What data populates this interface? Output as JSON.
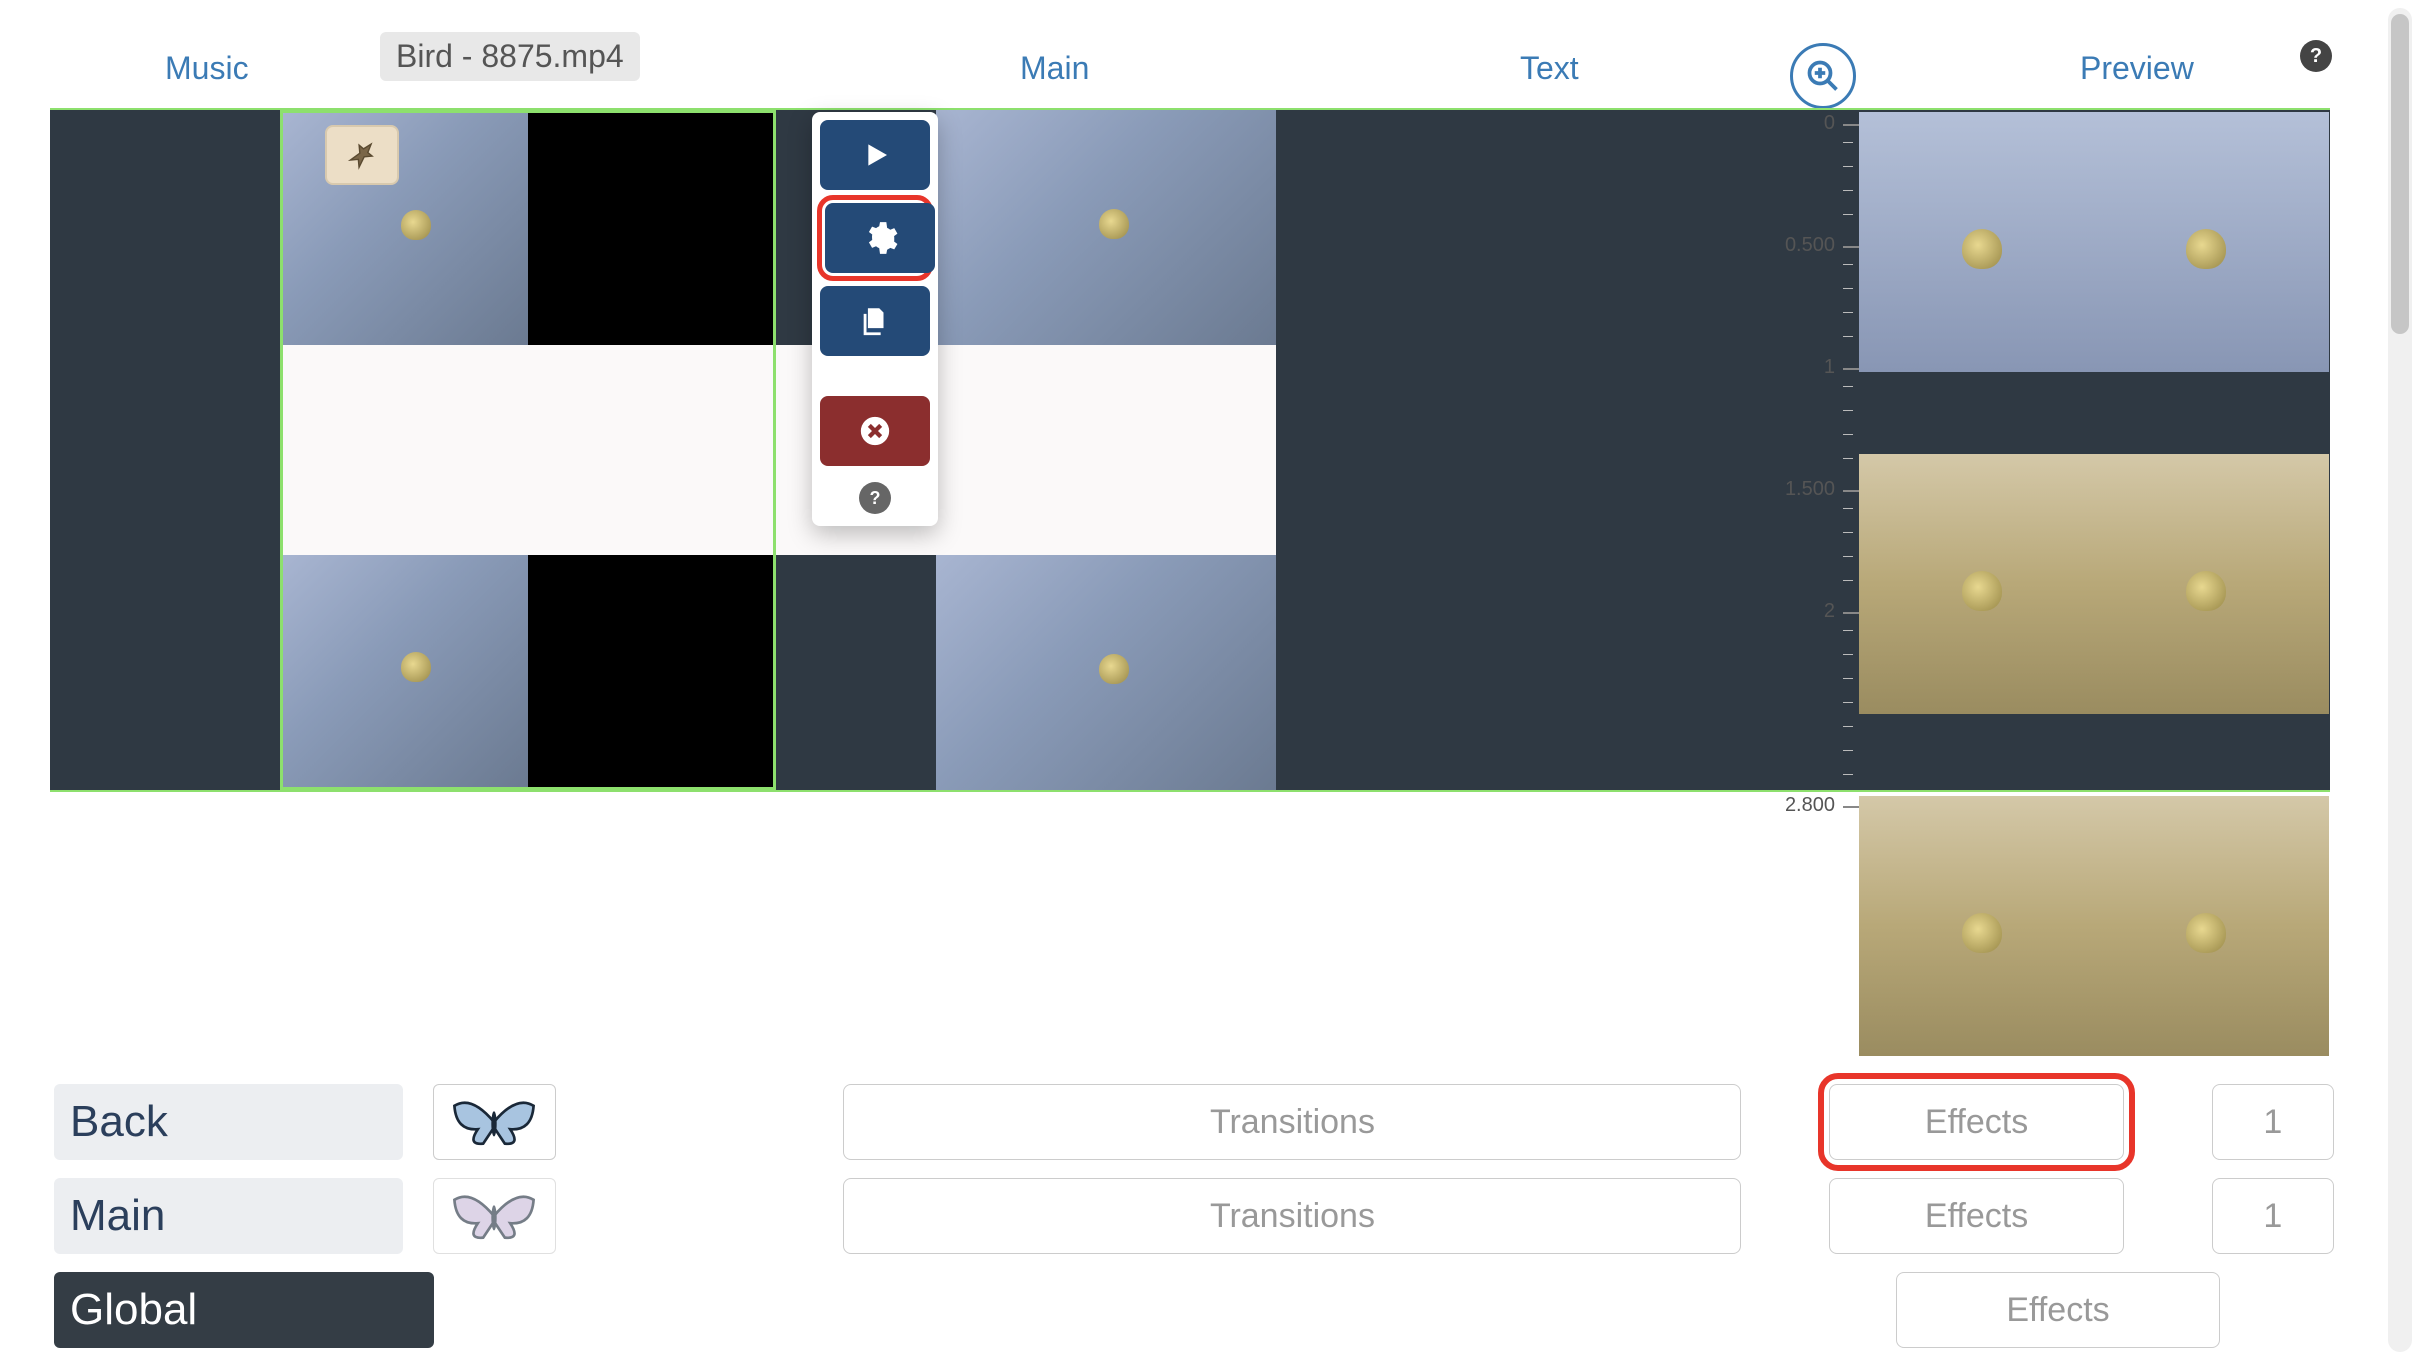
{
  "tabs": {
    "music": "Music",
    "main": "Main",
    "text": "Text",
    "preview": "Preview"
  },
  "file_chip": "Bird - 8875.mp4",
  "ruler_marks": {
    "m0": "0",
    "m05": "0.500",
    "m1": "1",
    "m15": "1.500",
    "m2": "2",
    "m28": "2.800"
  },
  "bottom": {
    "rows": {
      "back": {
        "label": "Back",
        "transitions": "Transitions",
        "effects": "Effects",
        "count": "1"
      },
      "main": {
        "label": "Main",
        "transitions": "Transitions",
        "effects": "Effects",
        "count": "1"
      },
      "global": {
        "label": "Global",
        "effects": "Effects"
      }
    }
  },
  "toolbar": {
    "play": "play",
    "settings": "settings",
    "copy": "copy",
    "delete": "delete",
    "help": "?"
  },
  "help_icon": "?"
}
